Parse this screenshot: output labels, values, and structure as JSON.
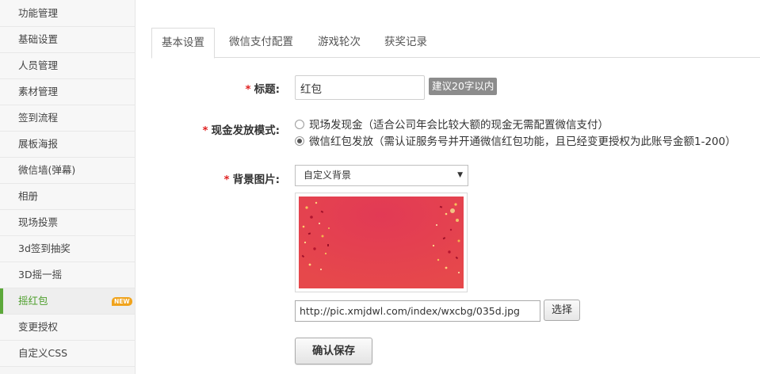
{
  "sidebar": {
    "items": [
      {
        "label": "功能管理"
      },
      {
        "label": "基础设置"
      },
      {
        "label": "人员管理"
      },
      {
        "label": "素材管理"
      },
      {
        "label": "签到流程"
      },
      {
        "label": "展板海报"
      },
      {
        "label": "微信墙(弹幕)"
      },
      {
        "label": "相册"
      },
      {
        "label": "现场投票"
      },
      {
        "label": "3d签到抽奖"
      },
      {
        "label": "3D摇一摇"
      },
      {
        "label": "摇红包",
        "badge": "NEW",
        "active": true
      },
      {
        "label": "变更授权"
      },
      {
        "label": "自定义CSS"
      }
    ]
  },
  "tabs": [
    {
      "label": "基本设置",
      "active": true
    },
    {
      "label": "微信支付配置"
    },
    {
      "label": "游戏轮次"
    },
    {
      "label": "获奖记录"
    }
  ],
  "form": {
    "required_mark": "*",
    "title": {
      "label": "标题:",
      "value": "红包",
      "hint": "建议20字以内"
    },
    "cash_mode": {
      "label": "现金发放模式:",
      "options": [
        {
          "label": "现场发现金（适合公司年会比较大额的现金无需配置微信支付）",
          "checked": false
        },
        {
          "label": "微信红包发放（需认证服务号并开通微信红包功能，且已经变更授权为此账号金额1-200）",
          "checked": true
        }
      ]
    },
    "background": {
      "label": "背景图片:",
      "selected": "自定义背景",
      "url": "http://pic.xmjdwl.com/index/wxcbg/035d.jpg",
      "choose_label": "选择"
    },
    "save_label": "确认保存"
  },
  "colors": {
    "accent_green": "#5ca83a",
    "required_red": "#e02020",
    "badge_orange": "#f0a31c",
    "preview_red": "#e5404a"
  }
}
